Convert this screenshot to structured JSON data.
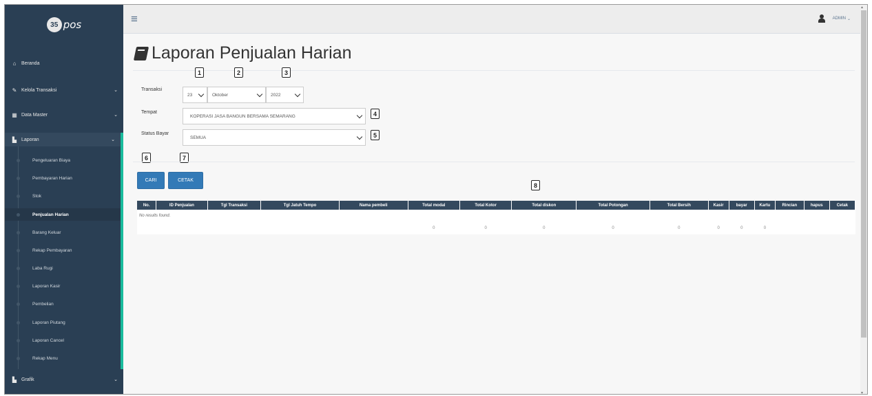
{
  "app": {
    "logo_text": "pos",
    "logo_badge": "35"
  },
  "sidebar": {
    "items": [
      {
        "label": "Beranda",
        "icon": "home-icon"
      },
      {
        "label": "Kelola Transaksi",
        "icon": "edit-icon"
      },
      {
        "label": "Data Master",
        "icon": "table-icon"
      },
      {
        "label": "Laporan",
        "icon": "chart-icon"
      },
      {
        "label": "Grafik",
        "icon": "chart-icon"
      }
    ],
    "laporan_sub": [
      "Pengeluaran Biaya",
      "Pembayaran Harian",
      "Stok",
      "Penjualan Harian",
      "Barang Keluar",
      "Rekap Pembayaran",
      "Laba Rugi",
      "Laporan Kasir",
      "Pembelian",
      "Laporan Piutang",
      "Laporan Cancel",
      "Rekap Menu"
    ]
  },
  "topbar": {
    "user": "ADMIN"
  },
  "page": {
    "title": "Laporan Penjualan Harian"
  },
  "form": {
    "transaksi_label": "Transaksi",
    "day": "23",
    "month": "Oktober",
    "year": "2022",
    "tempat_label": "Tempat",
    "tempat_value": "KOPERASI JASA BANGUN BERSAMA SEMARANG",
    "status_label": "Status Bayar",
    "status_value": "SEMUA",
    "cari": "CARI",
    "cetak": "CETAK"
  },
  "markers": [
    "1",
    "2",
    "3",
    "4",
    "5",
    "6",
    "7",
    "8"
  ],
  "table": {
    "columns": [
      "No.",
      "ID Penjualan",
      "Tgl Transaksi",
      "Tgl Jatuh Tempo",
      "Nama pembeli",
      "Total modal",
      "Total Kotor",
      "Total diskon",
      "Total Potongan",
      "Total Bersih",
      "Kasir",
      "bayar",
      "Kartu",
      "Rincian",
      "hapus",
      "Cetak"
    ],
    "empty_text": "No results found.",
    "totals": [
      "0",
      "0",
      "0",
      "0",
      "0",
      "0",
      "0",
      "0"
    ]
  },
  "colors": {
    "sidebar": "#2a3f54",
    "accent": "#1abb9c",
    "button": "#337ab7",
    "table_header": "#34495e"
  }
}
